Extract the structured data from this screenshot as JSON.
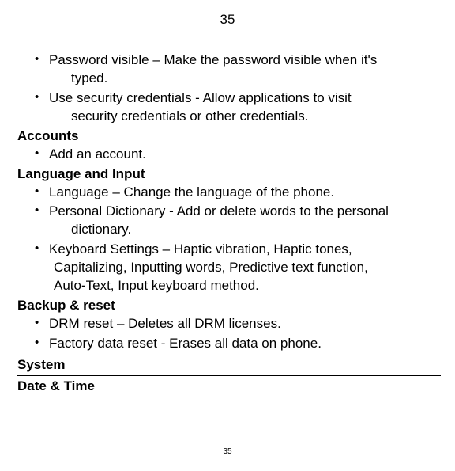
{
  "page_number_top": "35",
  "page_number_bottom": "35",
  "items": {
    "password_visible_1": "Password visible – Make the password visible when it's",
    "password_visible_2": "typed.",
    "security_creds_1": "Use security credentials - Allow applications to visit",
    "security_creds_2": "security credentials or other credentials.",
    "add_account": "Add an account.",
    "language": "Language – Change the language of the phone.",
    "personal_dict_1": "Personal Dictionary - Add or delete words to the personal",
    "personal_dict_2": "dictionary.",
    "keyboard_1": "Keyboard Settings – Haptic vibration, Haptic tones,",
    "keyboard_2": "Capitalizing, Inputting words, Predictive text function,",
    "keyboard_3": "Auto-Text, Input keyboard method.",
    "drm_reset": "DRM reset – Deletes all DRM licenses.",
    "factory_reset": "Factory data reset - Erases all data on phone."
  },
  "headings": {
    "accounts": "Accounts",
    "language_input": "Language and Input",
    "backup_reset": "Backup & reset",
    "system": "System",
    "date_time": "Date & Time"
  }
}
